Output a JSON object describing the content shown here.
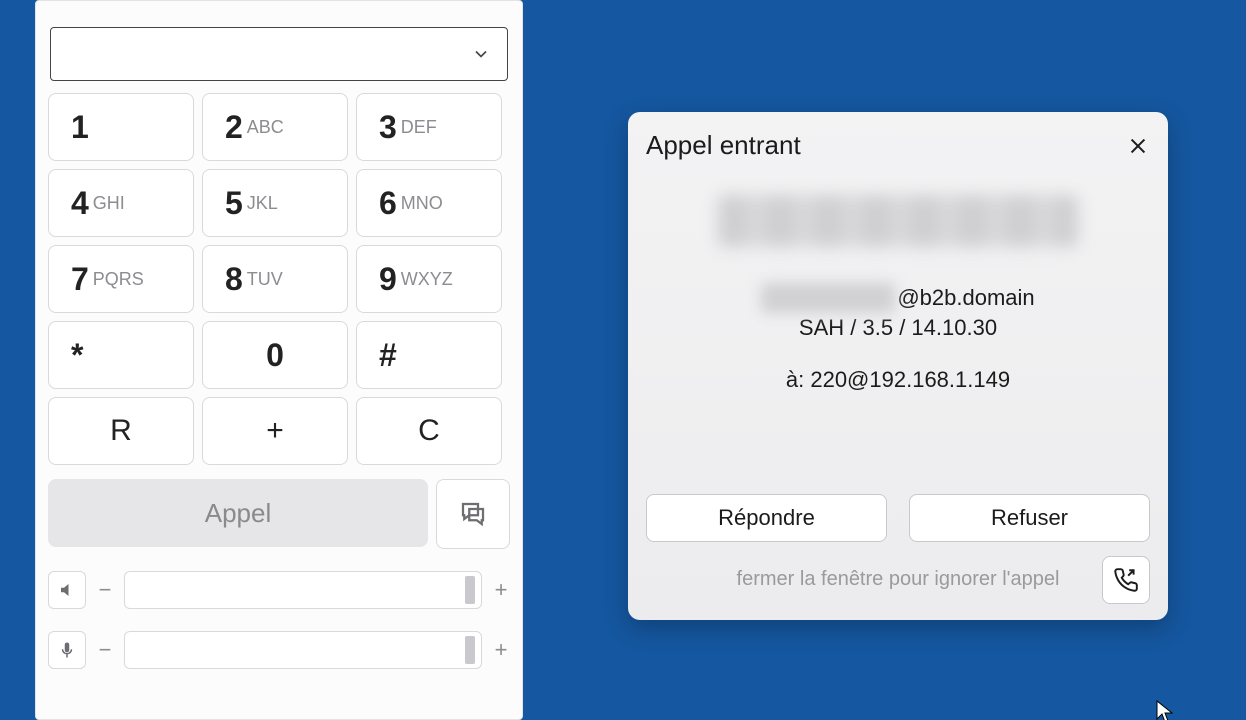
{
  "dialer": {
    "number_value": "",
    "keys": {
      "k1": {
        "digit": "1",
        "letters": ""
      },
      "k2": {
        "digit": "2",
        "letters": "ABC"
      },
      "k3": {
        "digit": "3",
        "letters": "DEF"
      },
      "k4": {
        "digit": "4",
        "letters": "GHI"
      },
      "k5": {
        "digit": "5",
        "letters": "JKL"
      },
      "k6": {
        "digit": "6",
        "letters": "MNO"
      },
      "k7": {
        "digit": "7",
        "letters": "PQRS"
      },
      "k8": {
        "digit": "8",
        "letters": "TUV"
      },
      "k9": {
        "digit": "9",
        "letters": "WXYZ"
      },
      "kstar": {
        "digit": "*"
      },
      "k0": {
        "digit": "0"
      },
      "khash": {
        "digit": "#"
      },
      "kR": {
        "digit": "R"
      },
      "kplus": {
        "digit": "+"
      },
      "kC": {
        "digit": "C"
      }
    },
    "call_label": "Appel",
    "volume": {
      "minus": "−",
      "plus": "+"
    },
    "mic": {
      "minus": "−",
      "plus": "+"
    }
  },
  "incoming": {
    "title": "Appel entrant",
    "domain_suffix": "@b2b.domain",
    "line2": "SAH / 3.5 / 14.10.30",
    "to_line": "à: 220@192.168.1.149",
    "answer_label": "Répondre",
    "reject_label": "Refuser",
    "hint": "fermer la fenêtre pour ignorer l'appel"
  }
}
